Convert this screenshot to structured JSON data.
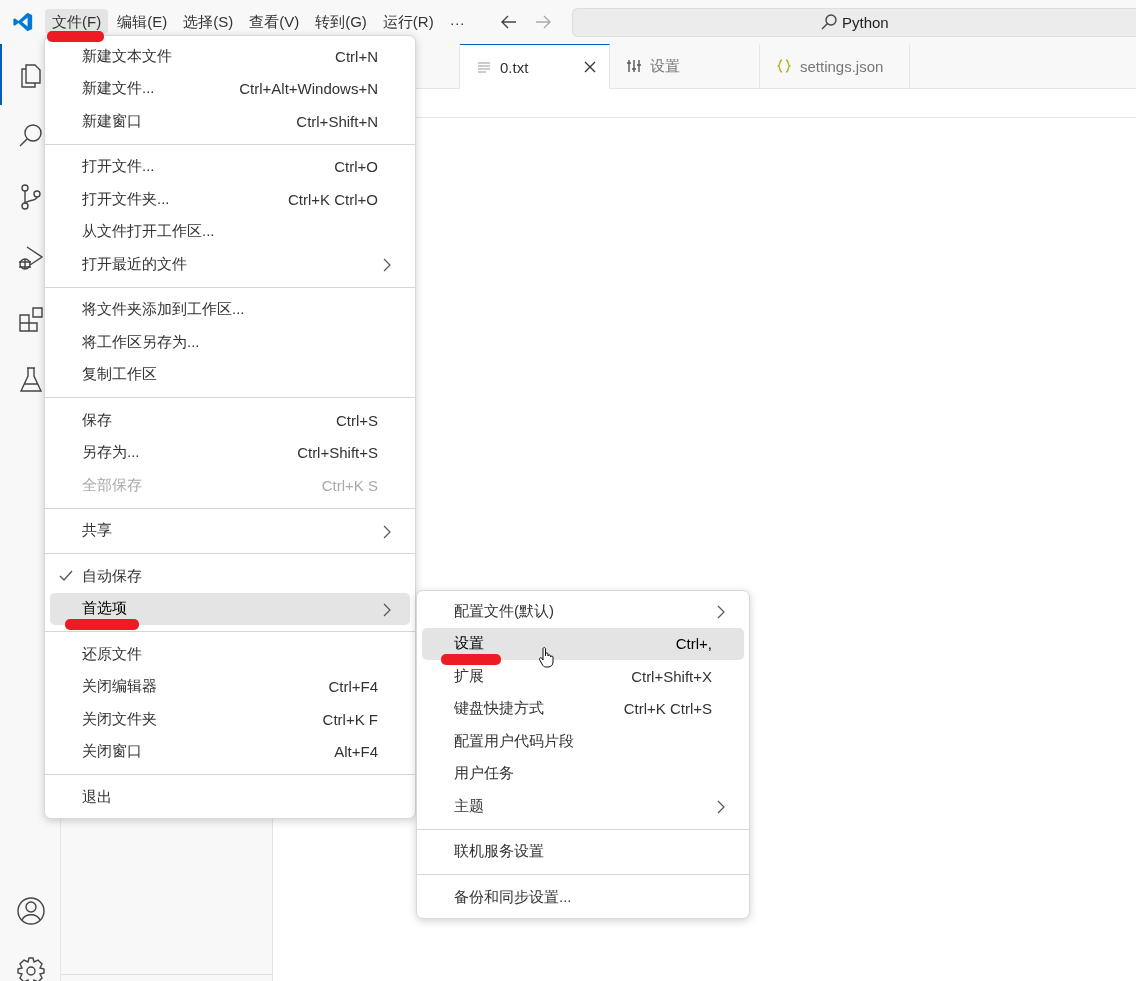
{
  "menu_bar": {
    "items": [
      {
        "label": "文件(F)",
        "selected": true,
        "marked": true
      },
      {
        "label": "编辑(E)",
        "selected": false,
        "marked": false
      },
      {
        "label": "选择(S)",
        "selected": false,
        "marked": false
      },
      {
        "label": "查看(V)",
        "selected": false,
        "marked": false
      },
      {
        "label": "转到(G)",
        "selected": false,
        "marked": false
      },
      {
        "label": "运行(R)",
        "selected": false,
        "marked": false
      },
      {
        "label": "···",
        "selected": false,
        "marked": false
      }
    ]
  },
  "search": {
    "value": "Python"
  },
  "activity_bar": {
    "items": [
      {
        "kind": "files",
        "selected": true
      },
      {
        "kind": "search",
        "selected": false
      },
      {
        "kind": "source-control",
        "selected": false
      },
      {
        "kind": "run",
        "selected": false
      },
      {
        "kind": "extensions",
        "selected": false
      },
      {
        "kind": "testing",
        "selected": false
      }
    ],
    "bottom": [
      {
        "kind": "account",
        "selected": false
      },
      {
        "kind": "settings",
        "selected": false
      }
    ]
  },
  "tabs": [
    {
      "label": "0.txt",
      "kind": "text",
      "selected": true,
      "closable": true
    },
    {
      "label": "设置",
      "kind": "settings",
      "selected": false,
      "closable": false
    },
    {
      "label": "settings.json",
      "kind": "json",
      "selected": false,
      "closable": false
    }
  ],
  "file_menu": {
    "groups": [
      [
        {
          "label": "新建文本文件",
          "shortcut": "Ctrl+N",
          "submenu": false,
          "disabled": false,
          "checked": false,
          "selected": false,
          "marked": false
        },
        {
          "label": "新建文件...",
          "shortcut": "Ctrl+Alt+Windows+N",
          "submenu": false,
          "disabled": false,
          "checked": false,
          "selected": false,
          "marked": false
        },
        {
          "label": "新建窗口",
          "shortcut": "Ctrl+Shift+N",
          "submenu": false,
          "disabled": false,
          "checked": false,
          "selected": false,
          "marked": false
        }
      ],
      [
        {
          "label": "打开文件...",
          "shortcut": "Ctrl+O",
          "submenu": false,
          "disabled": false,
          "checked": false,
          "selected": false,
          "marked": false
        },
        {
          "label": "打开文件夹...",
          "shortcut": "Ctrl+K Ctrl+O",
          "submenu": false,
          "disabled": false,
          "checked": false,
          "selected": false,
          "marked": false
        },
        {
          "label": "从文件打开工作区...",
          "submenu": false,
          "disabled": false,
          "checked": false,
          "selected": false,
          "marked": false
        },
        {
          "label": "打开最近的文件",
          "submenu": true,
          "disabled": false,
          "checked": false,
          "selected": false,
          "marked": false
        }
      ],
      [
        {
          "label": "将文件夹添加到工作区...",
          "submenu": false,
          "disabled": false,
          "checked": false,
          "selected": false,
          "marked": false
        },
        {
          "label": "将工作区另存为...",
          "submenu": false,
          "disabled": false,
          "checked": false,
          "selected": false,
          "marked": false
        },
        {
          "label": "复制工作区",
          "submenu": false,
          "disabled": false,
          "checked": false,
          "selected": false,
          "marked": false
        }
      ],
      [
        {
          "label": "保存",
          "shortcut": "Ctrl+S",
          "submenu": false,
          "disabled": false,
          "checked": false,
          "selected": false,
          "marked": false
        },
        {
          "label": "另存为...",
          "shortcut": "Ctrl+Shift+S",
          "submenu": false,
          "disabled": false,
          "checked": false,
          "selected": false,
          "marked": false
        },
        {
          "label": "全部保存",
          "shortcut": "Ctrl+K S",
          "submenu": false,
          "disabled": true,
          "checked": false,
          "selected": false,
          "marked": false
        }
      ],
      [
        {
          "label": "共享",
          "submenu": true,
          "disabled": false,
          "checked": false,
          "selected": false,
          "marked": false
        }
      ],
      [
        {
          "label": "自动保存",
          "submenu": false,
          "disabled": false,
          "checked": true,
          "selected": false,
          "marked": false
        },
        {
          "label": "首选项",
          "submenu": true,
          "disabled": false,
          "checked": false,
          "selected": true,
          "marked": true
        }
      ],
      [
        {
          "label": "还原文件",
          "submenu": false,
          "disabled": false,
          "checked": false,
          "selected": false,
          "marked": false
        },
        {
          "label": "关闭编辑器",
          "shortcut": "Ctrl+F4",
          "submenu": false,
          "disabled": false,
          "checked": false,
          "selected": false,
          "marked": false
        },
        {
          "label": "关闭文件夹",
          "shortcut": "Ctrl+K F",
          "submenu": false,
          "disabled": false,
          "checked": false,
          "selected": false,
          "marked": false
        },
        {
          "label": "关闭窗口",
          "shortcut": "Alt+F4",
          "submenu": false,
          "disabled": false,
          "checked": false,
          "selected": false,
          "marked": false
        }
      ],
      [
        {
          "label": "退出",
          "submenu": false,
          "disabled": false,
          "checked": false,
          "selected": false,
          "marked": false
        }
      ]
    ]
  },
  "preferences_menu": {
    "groups": [
      [
        {
          "label": "配置文件(默认)",
          "submenu": true,
          "selected": false,
          "marked": false,
          "pointer": false
        },
        {
          "label": "设置",
          "shortcut": "Ctrl+,",
          "submenu": false,
          "selected": true,
          "marked": true,
          "pointer": true
        },
        {
          "label": "扩展",
          "shortcut": "Ctrl+Shift+X",
          "submenu": false,
          "selected": false,
          "marked": false,
          "pointer": false
        },
        {
          "label": "键盘快捷方式",
          "shortcut": "Ctrl+K Ctrl+S",
          "submenu": false,
          "selected": false,
          "marked": false,
          "pointer": false
        },
        {
          "label": "配置用户代码片段",
          "submenu": false,
          "selected": false,
          "marked": false,
          "pointer": false
        },
        {
          "label": "用户任务",
          "submenu": false,
          "selected": false,
          "marked": false,
          "pointer": false
        },
        {
          "label": "主题",
          "submenu": true,
          "selected": false,
          "marked": false,
          "pointer": false
        }
      ],
      [
        {
          "label": "联机服务设置",
          "submenu": false,
          "selected": false,
          "marked": false,
          "pointer": false
        }
      ],
      [
        {
          "label": "备份和同步设置...",
          "submenu": false,
          "selected": false,
          "marked": false,
          "pointer": false
        }
      ]
    ]
  }
}
